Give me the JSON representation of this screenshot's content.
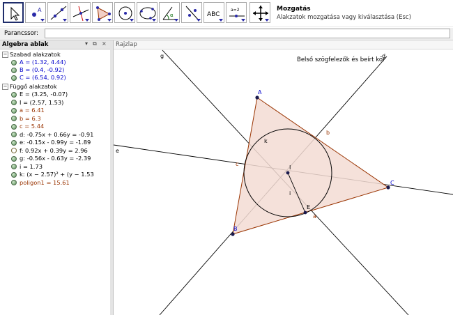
{
  "toolbar": {
    "active_tool_title": "Mozgatás",
    "active_tool_desc": "Alakzatok mozgatása vagy kiválasztása (Esc)",
    "tools": [
      {
        "icon": "move-arrow-icon"
      },
      {
        "icon": "new-point-icon",
        "glyph": "A"
      },
      {
        "icon": "line-through-two-points-icon"
      },
      {
        "icon": "perpendicular-line-icon"
      },
      {
        "icon": "polygon-icon"
      },
      {
        "icon": "circle-center-point-icon"
      },
      {
        "icon": "conic-five-points-icon"
      },
      {
        "icon": "angle-icon",
        "glyph": "α"
      },
      {
        "icon": "reflect-about-line-icon"
      },
      {
        "icon": "insert-text-icon",
        "glyph": "ABC"
      },
      {
        "icon": "slider-icon",
        "glyph": "a=2"
      },
      {
        "icon": "move-graphics-view-icon"
      }
    ]
  },
  "input": {
    "label": "Parancssor:",
    "value": ""
  },
  "algebra": {
    "title": "Algebra ablak",
    "free_folder": "Szabad alakzatok",
    "dep_folder": "Függő alakzatok",
    "free": [
      {
        "text": "A = (1.32, 4.44)",
        "color": "blue"
      },
      {
        "text": "B = (0.4, -0.92)",
        "color": "blue"
      },
      {
        "text": "C = (6.54, 0.92)",
        "color": "blue"
      }
    ],
    "dependent": [
      {
        "text": "E = (3.25, -0.07)",
        "color": "black",
        "shown": true
      },
      {
        "text": "I = (2.57, 1.53)",
        "color": "black",
        "shown": true
      },
      {
        "text": "a = 6.41",
        "color": "brown",
        "shown": true
      },
      {
        "text": "b = 6.3",
        "color": "brown",
        "shown": true
      },
      {
        "text": "c = 5.44",
        "color": "brown",
        "shown": true
      },
      {
        "text": "d: -0.75x + 0.66y = -0.91",
        "color": "black",
        "shown": true
      },
      {
        "text": "e: -0.15x - 0.99y = -1.89",
        "color": "black",
        "shown": true
      },
      {
        "text": "f: 0.92x + 0.39y = 2.96",
        "color": "black",
        "shown": false
      },
      {
        "text": "g: -0.56x - 0.63y = -2.39",
        "color": "black",
        "shown": true
      },
      {
        "text": "i = 1.73",
        "color": "black",
        "shown": true
      },
      {
        "text": "k: (x − 2.57)² + (y − 1.53",
        "color": "black",
        "shown": true
      },
      {
        "text": "poligon1 = 15.61",
        "color": "brown",
        "shown": true
      }
    ]
  },
  "graphics": {
    "title": "Rajzlap",
    "caption": "Belső szögfelezők és beírt kör",
    "labels": {
      "A": "A",
      "B": "B",
      "C": "C",
      "E": "E",
      "I": "I",
      "a": "a",
      "b": "b",
      "c": "c",
      "d": "d",
      "e": "e",
      "g": "g",
      "i": "i",
      "k": "k"
    },
    "colors": {
      "polygon_fill": "#f3dcd3",
      "polygon_edge": "#993300",
      "point": "#1a1a4d",
      "point_label": "#0000cc",
      "line": "#000000"
    }
  }
}
